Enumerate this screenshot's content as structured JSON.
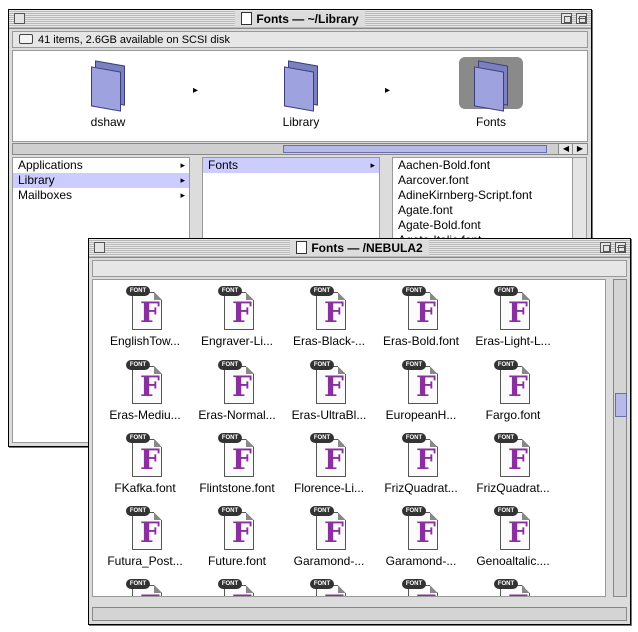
{
  "back_window": {
    "title": "Fonts — ~/Library",
    "info": "41 items, 2.6GB available on SCSI disk",
    "path_items": [
      {
        "label": "dshaw",
        "icon": "home-folder-icon"
      },
      {
        "label": "Library",
        "icon": "library-folder-icon"
      },
      {
        "label": "Fonts",
        "icon": "folder-icon"
      }
    ],
    "col1": [
      "Applications",
      "Library",
      "Mailboxes"
    ],
    "col2": [
      "Fonts"
    ],
    "col3": [
      "Aachen-Bold.font",
      "Aarcover.font",
      "AdineKirnberg-Script.font",
      "Agate.font",
      "Agate-Bold.font",
      "Agate-Italic.font"
    ]
  },
  "front_window": {
    "title": "Fonts — /NEBULA2",
    "icon_badge": "FONT",
    "icon_letter": "F",
    "rows": [
      [
        "EnglishTow...",
        "Engraver-Li...",
        "Eras-Black-...",
        "Eras-Bold.font",
        "Eras-Light-L..."
      ],
      [
        "Eras-Mediu...",
        "Eras-Normal...",
        "Eras-UltraBl...",
        "EuropeanH...",
        "Fargo.font"
      ],
      [
        "FKafka.font",
        "Flintstone.font",
        "Florence-Li...",
        "FrizQuadrat...",
        "FrizQuadrat..."
      ],
      [
        "Futura_Post...",
        "Future.font",
        "Garamond-...",
        "Garamond-...",
        "Genoaltalic...."
      ]
    ]
  }
}
